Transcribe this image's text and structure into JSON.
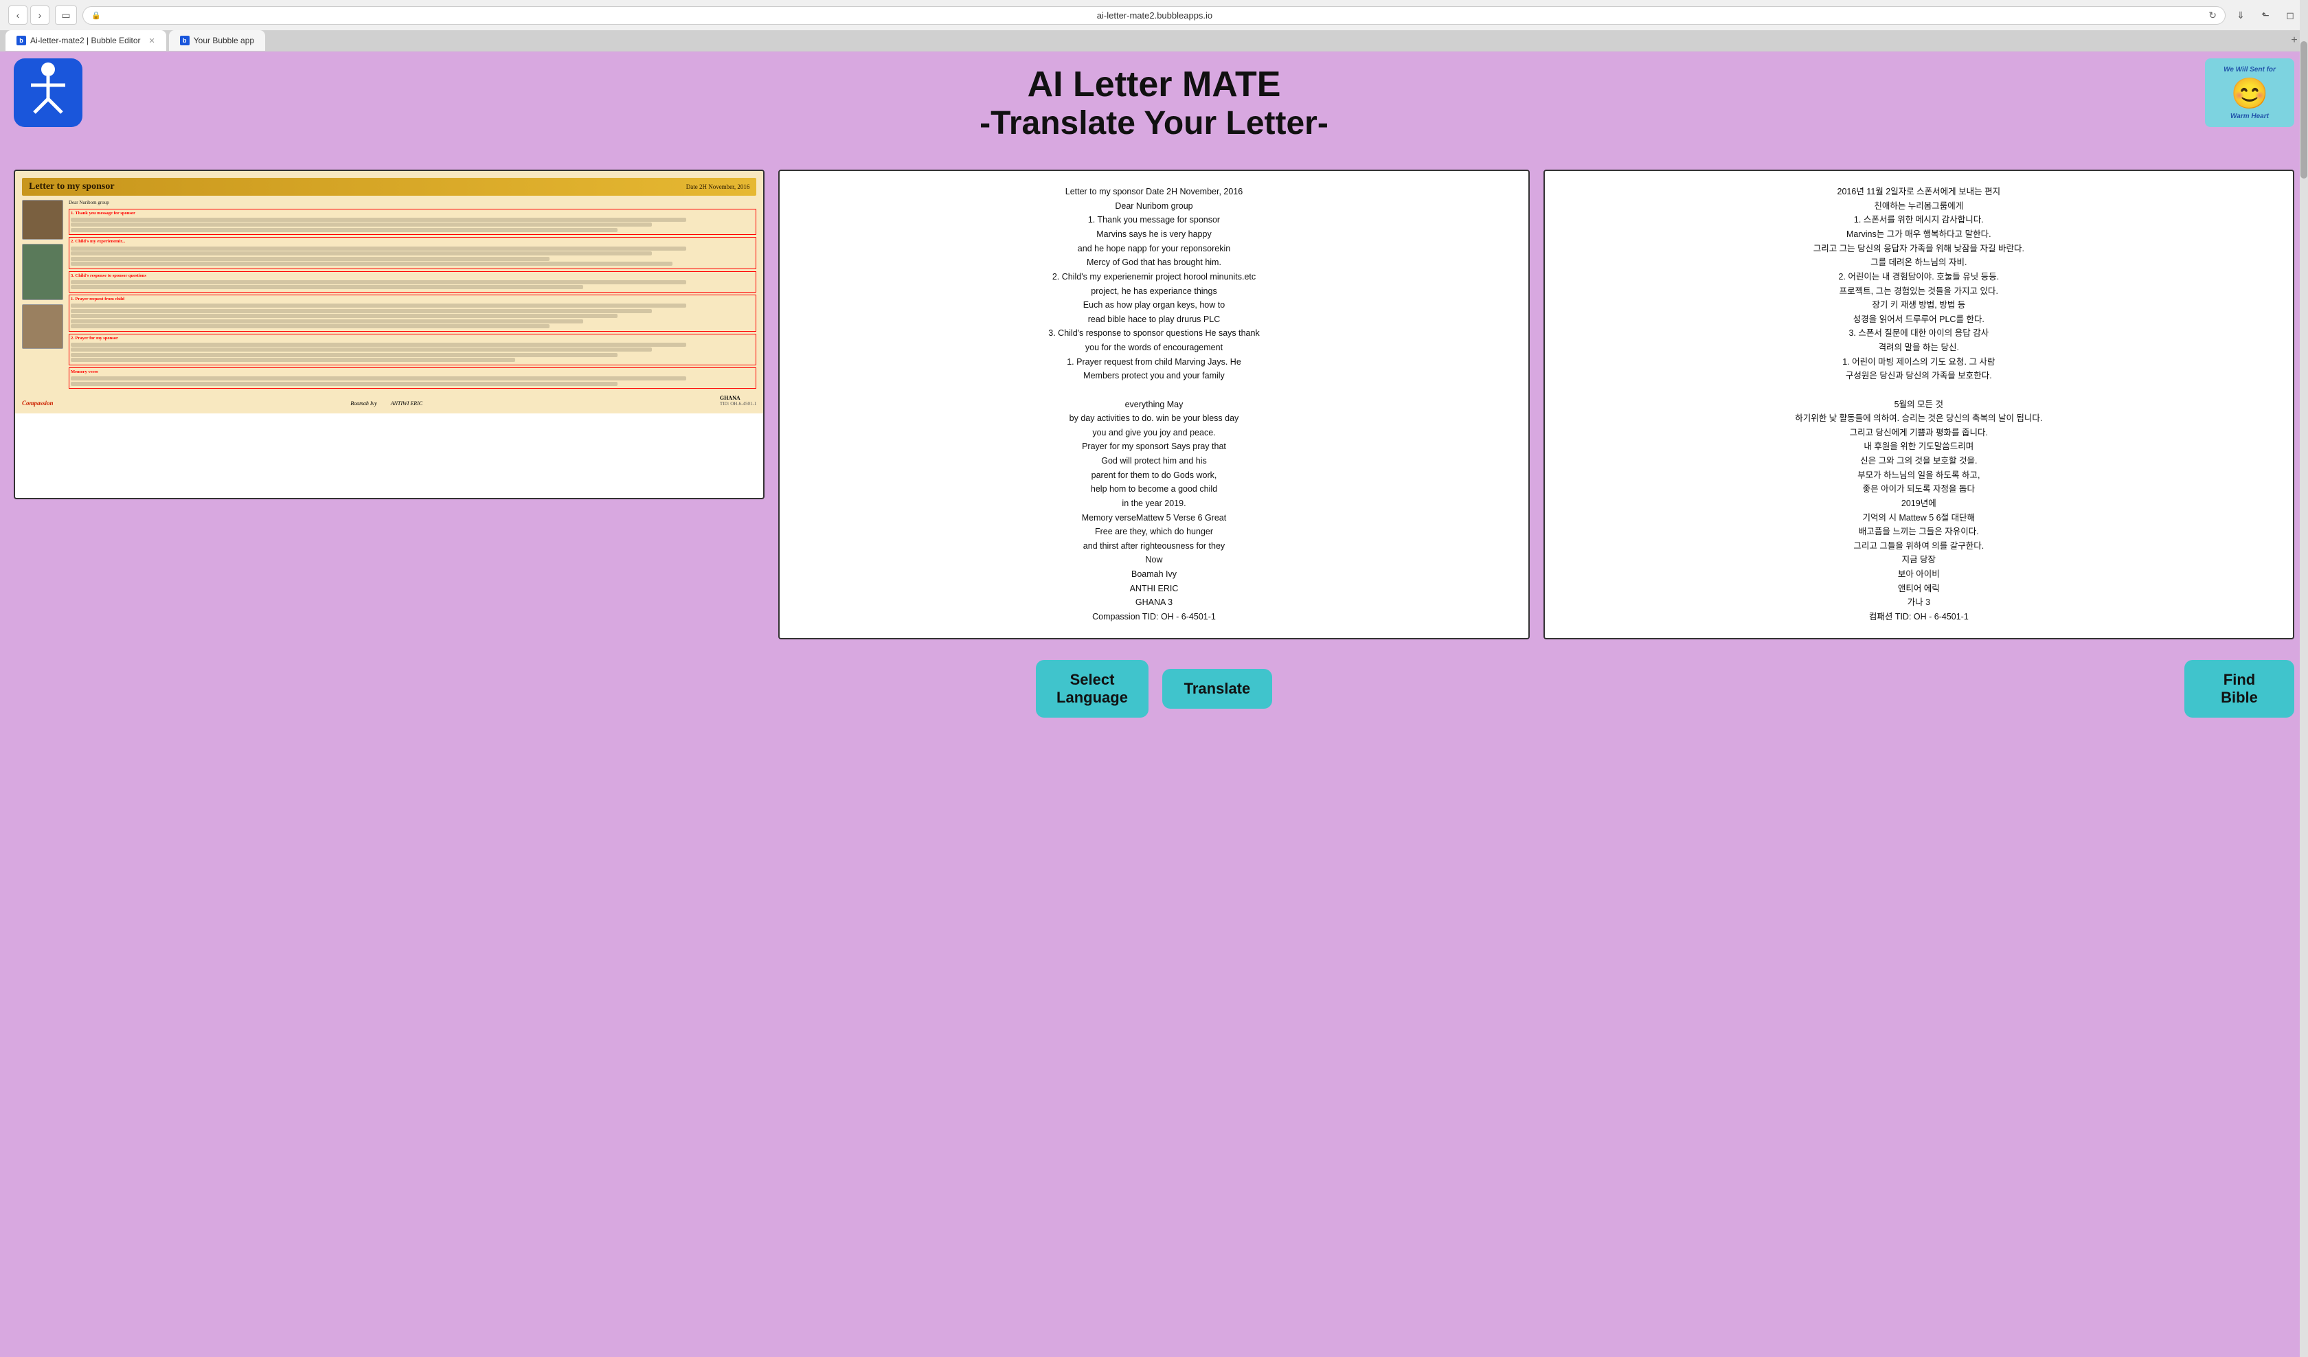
{
  "browser": {
    "url": "ai-letter-mate2.bubbleapps.io",
    "tab1_label": "Ai-letter-mate2 | Bubble Editor",
    "tab2_label": "Your Bubble app",
    "tab1_icon": "b",
    "tab2_icon": "b"
  },
  "header": {
    "title_line1": "AI Letter MATE",
    "title_line2": "-Translate Your Letter-",
    "smiley_top": "We Will Sent for",
    "smiley_bottom": "Warm Heart"
  },
  "letter_image": {
    "title": "Letter to my sponsor",
    "date": "Date 2H November, 2016",
    "recipient": "Dear Nuribom group",
    "section1_label": "1. Thank you message for sponsor",
    "section2_label": "2. Child's my experienemir...",
    "section3_label": "3. Child's response to sponsor questions",
    "section4_label": "1. Prayer request from child",
    "section5_label": "2. Prayer for my sponsor",
    "section6_label": "Memory verse",
    "signature_left": "Boamah Ivy",
    "signature_right": "ANTIWI ERIC",
    "footer_ghana": "GHANA",
    "footer_tid": "TID: OH-6-4501-1",
    "footer_compassion": "Compassion"
  },
  "english_text": {
    "content": "Letter to my sponsor Date 2H November, 2016\nDear Nuribom group\n1. Thank you message for sponsor\nMarvins says he is very happy\nand he hope napp for your reponsorekin\nMercy of God that has brought him.\n2. Child's my experienemir project horool minunits.etc\nproject, he has experiance things\nEuch as how play organ keys, how to\nread bible hace to play drurus PLC\n3. Child's response to sponsor questions He says thank\nyou for the words of encouragement\n1. Prayer request from child Marving Jays. He\nMembers protect you and your family\n\neverything May\nby day activities to do. win be your bless day\nyou and give you joy and peace.\nPrayer for my sponsort Says pray that\nGod will protect him and his\nparent for them to do Gods work,\nhelp hom to become a good child\nin the year 2019.\nMemory verseMattew 5 Verse 6 Great\nFree are they, which do hunger\nand thirst after righteousness for they\nNow\nBoamah Ivy\nANTHI ERIC\nGHANA 3\nCompassion TID: OH - 6-4501-1"
  },
  "korean_text": {
    "content": "2016년 11월 2일자로 스폰서에게 보내는 편지\n친애하는 누리봄그룹에게\n1. 스폰서를 위한 메시지 감사합니다.\nMarvins는 그가 매우 행복하다고 말한다.\n그리고 그는 당신의 응답자 가족을 위해 낮잠을 자길 바란다.\n그를 데려온 하느님의 자비.\n2. 어린이는 내 경험담이야. 호눌들 유닛 등등.\n프로젝트, 그는 경험있는 것들을 가지고 있다.\n장기 키 재생 방법, 방법 등\n성경을 읽어서 드루루어 PLC를 한다.\n3. 스폰서 질문에 대한 아이의 응답 감사\n격려의 말을 하는 당신.\n1. 어린이 마빙 제이스의 기도 요청. 그 사람\n구성원은 당신과 당신의 가족을 보호한다.\n\n5월의 모든 것\n하기위한 낮 활동들에 의하여. 승리는 것은 당신의 축복의 날이 됩니다.\n그리고 당신에게 기쁨과 평화를 줍니다.\n내 후원을 위한 기도말씀드리며\n신은 그와 그의 것을 보호할 것을.\n부모가 하느님의 일을 하도록 하고,\n좋은 아이가 되도록 자정을 돕다\n2019년에\n기억의 시 Mattew 5 6절 대단해\n배고픔을 느끼는 그들은 자유이다.\n그리고 그들을 위하여 의를 갈구한다.\n지금 당장\n보아 아이비\n앤티어 에릭\n가나 3\n컴패션 TID: OH - 6-4501-1"
  },
  "buttons": {
    "select_language_line1": "Select",
    "select_language_line2": "Language",
    "translate_label": "Translate",
    "find_bible_line1": "Find",
    "find_bible_line2": "Bible"
  }
}
